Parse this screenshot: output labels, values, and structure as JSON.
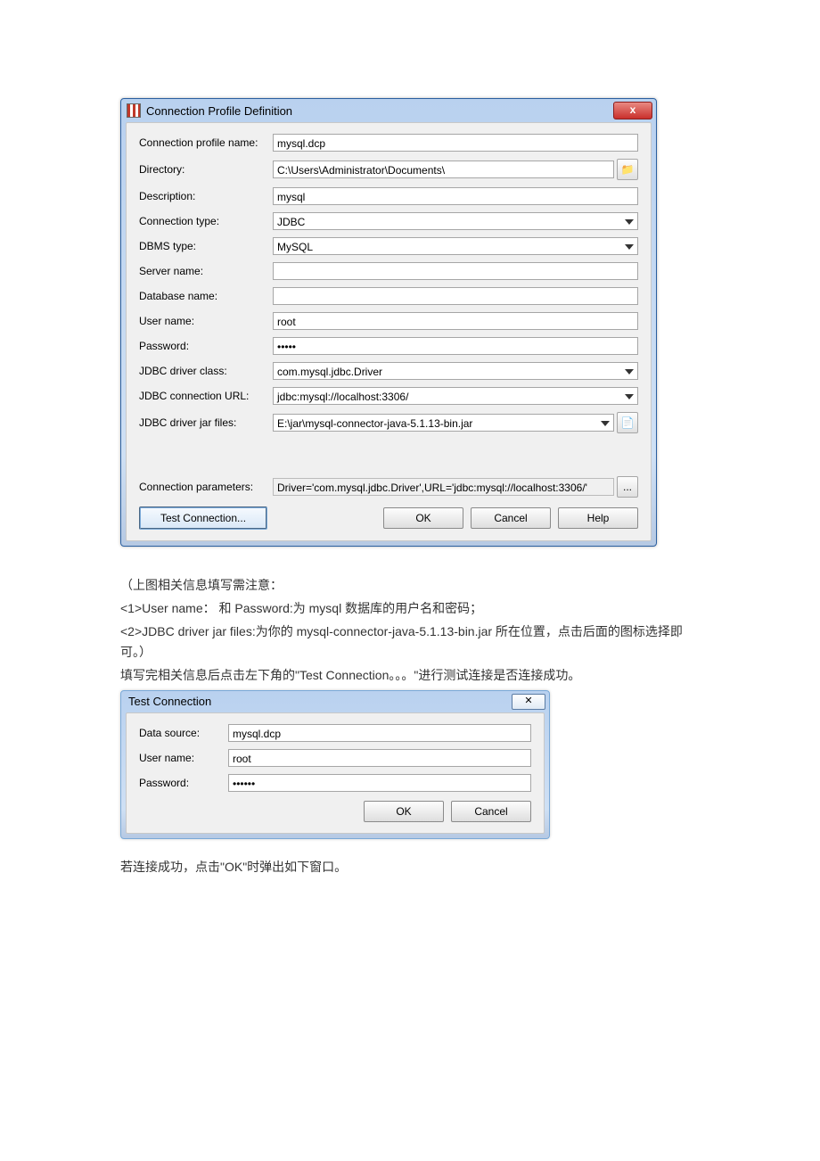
{
  "dialog1": {
    "title": "Connection Profile Definition",
    "close": "x",
    "labels": {
      "profile_name": "Connection profile name:",
      "directory": "Directory:",
      "description": "Description:",
      "conn_type": "Connection type:",
      "dbms_type": "DBMS type:",
      "server_name": "Server name:",
      "db_name": "Database name:",
      "user_name": "User name:",
      "password": "Password:",
      "driver_class": "JDBC driver class:",
      "conn_url": "JDBC connection URL:",
      "jar_files": "JDBC driver jar files:",
      "conn_params": "Connection parameters:"
    },
    "values": {
      "profile_name": "mysql.dcp",
      "directory": "C:\\Users\\Administrator\\Documents\\",
      "description": "mysql",
      "conn_type": "JDBC",
      "dbms_type": "MySQL",
      "server_name": "",
      "db_name": "",
      "user_name": "root",
      "password": "•••••",
      "driver_class": "com.mysql.jdbc.Driver",
      "conn_url": "jdbc:mysql://localhost:3306/",
      "jar_files": "E:\\jar\\mysql-connector-java-5.1.13-bin.jar",
      "conn_params": "Driver='com.mysql.jdbc.Driver',URL='jdbc:mysql://localhost:3306/'"
    },
    "buttons": {
      "test": "Test Connection...",
      "ok": "OK",
      "cancel": "Cancel",
      "help": "Help",
      "browse": "📁",
      "browse_file": "📄",
      "more": "..."
    }
  },
  "doc": {
    "p1": "（上图相关信息填写需注意：",
    "p2": "<1>User name： 和 Password:为 mysql 数据库的用户名和密码；",
    "p3": "<2>JDBC driver jar files:为你的 mysql-connector-java-5.1.13-bin.jar 所在位置，点击后面的图标选择即可。）",
    "p4": "填写完相关信息后点击左下角的\"Test Connection。。。\"进行测试连接是否连接成功。",
    "p5": "若连接成功，点击\"OK\"时弹出如下窗口。"
  },
  "dialog2": {
    "title": "Test Connection",
    "close": "✕",
    "labels": {
      "data_source": "Data source:",
      "user_name": "User name:",
      "password": "Password:"
    },
    "values": {
      "data_source": "mysql.dcp",
      "user_name": "root",
      "password": "••••••"
    },
    "buttons": {
      "ok": "OK",
      "cancel": "Cancel"
    }
  }
}
